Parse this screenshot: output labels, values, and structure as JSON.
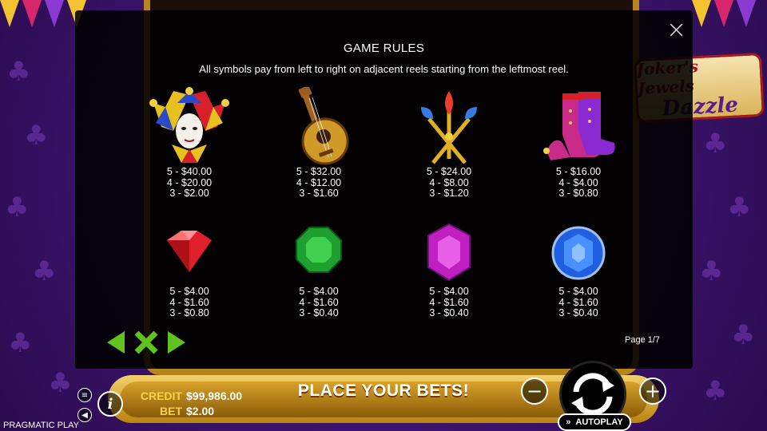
{
  "dialog": {
    "title": "GAME RULES",
    "subtitle": "All symbols pay from left to right on adjacent reels starting from the leftmost reel.",
    "page_indicator": "Page 1/7"
  },
  "symbols": [
    {
      "icon": "jester-mask-icon",
      "pays": [
        "5 - $40.00",
        "4 - $20.00",
        "3 - $2.00"
      ]
    },
    {
      "icon": "lute-icon",
      "pays": [
        "5 - $32.00",
        "4 - $12.00",
        "3 - $1.60"
      ]
    },
    {
      "icon": "scepters-icon",
      "pays": [
        "5 - $24.00",
        "4 - $8.00",
        "3 - $1.20"
      ]
    },
    {
      "icon": "jester-boots-icon",
      "pays": [
        "5 - $16.00",
        "4 - $4.00",
        "3 - $0.80"
      ]
    },
    {
      "icon": "red-gem-icon",
      "pays": [
        "5 - $4.00",
        "4 - $1.60",
        "3 - $0.80"
      ]
    },
    {
      "icon": "green-gem-icon",
      "pays": [
        "5 - $4.00",
        "4 - $1.60",
        "3 - $0.40"
      ]
    },
    {
      "icon": "purple-gem-icon",
      "pays": [
        "5 - $4.00",
        "4 - $1.60",
        "3 - $0.40"
      ]
    },
    {
      "icon": "blue-gem-icon",
      "pays": [
        "5 - $4.00",
        "4 - $1.60",
        "3 - $0.40"
      ]
    }
  ],
  "bottom": {
    "credit_label": "CREDIT",
    "credit_value": "$99,986.00",
    "bet_label": "BET",
    "bet_value": "$2.00",
    "message": "PLACE YOUR BETS!",
    "autoplay_label": "AUTOPLAY",
    "minus_label": "−",
    "plus_label": "+",
    "info_label": "i"
  },
  "provider": "PRAGMATIC PLAY",
  "logo": {
    "line1": "Joker's Jewels",
    "line2": "Dazzle"
  },
  "colors": {
    "nav_green": "#5fc21e",
    "gold": "#f8d24a",
    "dialog_bg": "#000000"
  }
}
